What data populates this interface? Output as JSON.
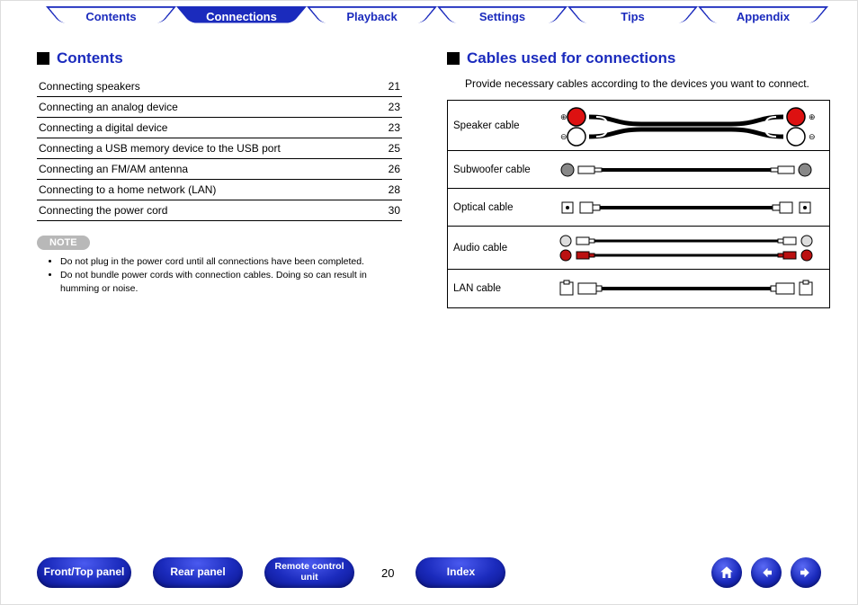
{
  "tabs": [
    {
      "label": "Contents",
      "active": false
    },
    {
      "label": "Connections",
      "active": true
    },
    {
      "label": "Playback",
      "active": false
    },
    {
      "label": "Settings",
      "active": false
    },
    {
      "label": "Tips",
      "active": false
    },
    {
      "label": "Appendix",
      "active": false
    }
  ],
  "left": {
    "title": "Contents",
    "toc": [
      {
        "title": "Connecting speakers",
        "page": "21"
      },
      {
        "title": "Connecting an analog device",
        "page": "23"
      },
      {
        "title": "Connecting a digital device",
        "page": "23"
      },
      {
        "title": "Connecting a USB memory device to the USB port",
        "page": "25"
      },
      {
        "title": "Connecting an FM/AM antenna",
        "page": "26"
      },
      {
        "title": "Connecting to a home network (LAN)",
        "page": "28"
      },
      {
        "title": "Connecting the power cord",
        "page": "30"
      }
    ],
    "note_label": "NOTE",
    "notes": [
      "Do not plug in the power cord until all connections have been completed.",
      "Do not bundle power cords with connection cables. Doing so can result in humming or noise."
    ]
  },
  "right": {
    "title": "Cables used for connections",
    "intro": "Provide necessary cables according to the devices you want to connect.",
    "cables": [
      {
        "label": "Speaker cable"
      },
      {
        "label": "Subwoofer cable"
      },
      {
        "label": "Optical cable"
      },
      {
        "label": "Audio cable"
      },
      {
        "label": "LAN cable"
      }
    ]
  },
  "bottom": {
    "btn1": "Front/Top panel",
    "btn2": "Rear panel",
    "btn3": "Remote control unit",
    "btn4": "Index",
    "page": "20"
  }
}
